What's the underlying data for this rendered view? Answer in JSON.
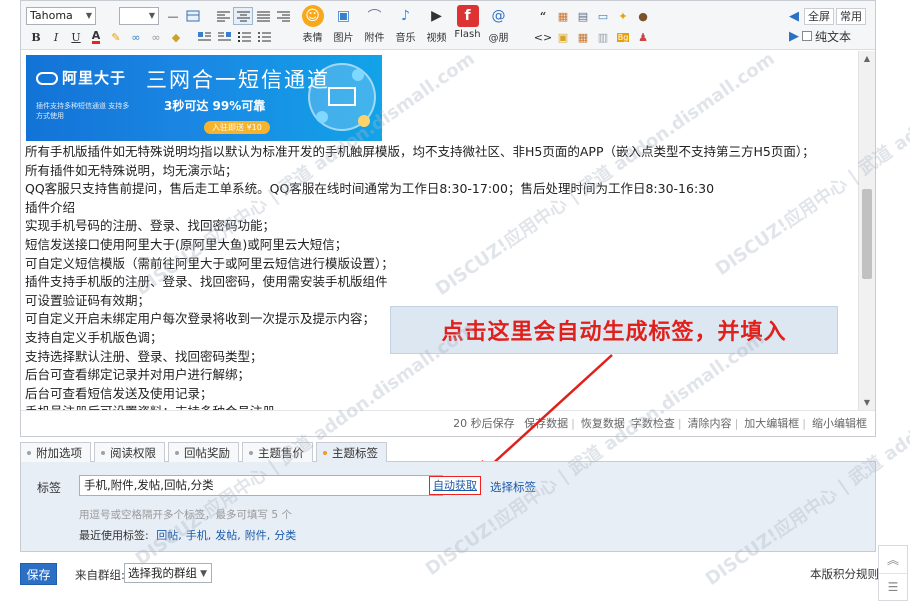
{
  "toolbar": {
    "font": "Tahoma",
    "big_buttons": [
      {
        "label": "表情",
        "icon": "emoji-icon",
        "color": "#f7a81b"
      },
      {
        "label": "图片",
        "icon": "image-icon",
        "color": "#3b7fc8"
      },
      {
        "label": "附件",
        "icon": "paperclip-icon",
        "color": "#6a7c91"
      },
      {
        "label": "音乐",
        "icon": "music-note-icon",
        "color": "#2f8fe0"
      },
      {
        "label": "视频",
        "icon": "video-clapper-icon",
        "color": "#333"
      },
      {
        "label": "Flash",
        "icon": "flash-icon",
        "color": "#d33"
      },
      {
        "label": "@朋",
        "icon": "at-sign-icon",
        "color": "#2f6fc5"
      }
    ],
    "fullscreen_label": "全屏",
    "common_label": "常用",
    "plaintext_label": "纯文本"
  },
  "banner": {
    "brand": "阿里大于",
    "headline": "三网合一短信通道",
    "sub_text": "插件支持多种短信通道 支持多方式使用",
    "speed_text": "3秒可达  99%可靠",
    "pill_text": "入驻即送 ¥10"
  },
  "content_lines": [
    "所有手机版插件如无特殊说明均指以默认为标准开发的手机触屏模版，均不支持微社区、非H5页面的APP（嵌入点类型不支持第三方H5页面）；",
    "所有插件如无特殊说明，均无演示站；",
    "QQ客服只支持售前提问，售后走工单系统。QQ客服在线时间通常为工作日8:30-17:00；售后处理时间为工作日8:30-16:30",
    "插件介绍",
    "实现手机号码的注册、登录、找回密码功能；",
    "短信发送接口使用阿里大于(原阿里大鱼)或阿里云大短信；",
    "可自定义短信模版（需前往阿里大于或阿里云短信进行模版设置）；",
    "插件支持手机版的注册、登录、找回密码，使用需安装手机版组件",
    "可设置验证码有效期；",
    "可自定义开启未绑定用户每次登录将收到一次提示及提示内容；",
    "支持自定义手机版色调；",
    "支持选择默认注册、登录、找回密码类型；",
    "后台可查看绑定记录并对用户进行解绑；",
    "后台可查看短信发送及使用记录；",
    "手机号注册后可设置资料；支持多种会员注册"
  ],
  "status_bar": {
    "autosave": "20 秒后保存",
    "items": [
      "保存数据",
      "恢复数据",
      "字数检查",
      "清除内容",
      "加大编辑框",
      "缩小编辑框"
    ]
  },
  "annotation": "点击这里会自动生成标签，并填入",
  "tabs": [
    "附加选项",
    "阅读权限",
    "回帖奖励",
    "主题售价",
    "主题标签"
  ],
  "tag_panel": {
    "label": "标签",
    "value": "手机,附件,发帖,回帖,分类",
    "auto_button": "自动获取",
    "choose_link": "选择标签",
    "hint": "用逗号或空格隔开多个标签，最多可填写 5 个",
    "recent_label": "最近使用标签:",
    "recent_tags": [
      "回帖,",
      "手机,",
      "发帖,",
      "附件,",
      "分类"
    ]
  },
  "footer": {
    "save": "保存",
    "from_group_label": "来自群组:",
    "group_select": "选择我的群组",
    "rules_link": "本版积分规则"
  },
  "watermark": "DISCUZ!应用中心 | 武道  addon.dismall.com"
}
